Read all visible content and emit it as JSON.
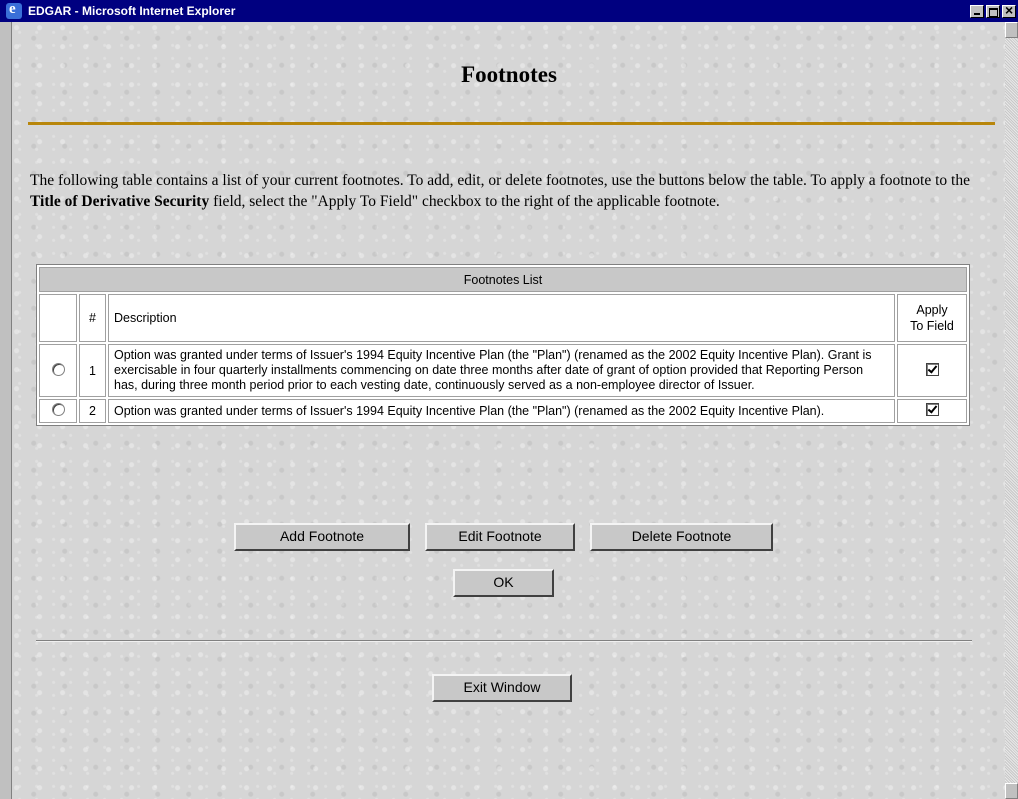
{
  "window": {
    "title": "EDGAR - Microsoft Internet Explorer"
  },
  "page": {
    "title": "Footnotes",
    "intro_part1": "The following table contains a list of your current footnotes. To add, edit, or delete footnotes, use the buttons below the table. To apply a footnote to the ",
    "intro_bold": "Title of Derivative Security",
    "intro_part2": " field, select the \"Apply To Field\" checkbox to the right of the applicable footnote."
  },
  "table": {
    "caption": "Footnotes List",
    "headers": {
      "number": "#",
      "description": "Description",
      "apply_line1": "Apply",
      "apply_line2": "To Field"
    },
    "rows": [
      {
        "number": "1",
        "description": "Option was granted under terms of Issuer's 1994 Equity Incentive Plan (the \"Plan\") (renamed as the 2002 Equity Incentive Plan). Grant is exercisable in four quarterly installments commencing on date three months after date of grant of option provided that Reporting Person has, during three month period prior to each vesting date, continuously served as a non-employee director of Issuer.",
        "selected": false,
        "apply_to_field": true
      },
      {
        "number": "2",
        "description": "Option was granted under terms of Issuer's 1994 Equity Incentive Plan (the \"Plan\") (renamed as the 2002 Equity Incentive Plan).",
        "selected": false,
        "apply_to_field": true
      }
    ]
  },
  "buttons": {
    "add": "Add Footnote",
    "edit": "Edit Footnote",
    "delete": "Delete Footnote",
    "ok": "OK",
    "exit": "Exit Window"
  },
  "colors": {
    "titlebar": "#000080",
    "accent_rule": "#b8860b"
  }
}
